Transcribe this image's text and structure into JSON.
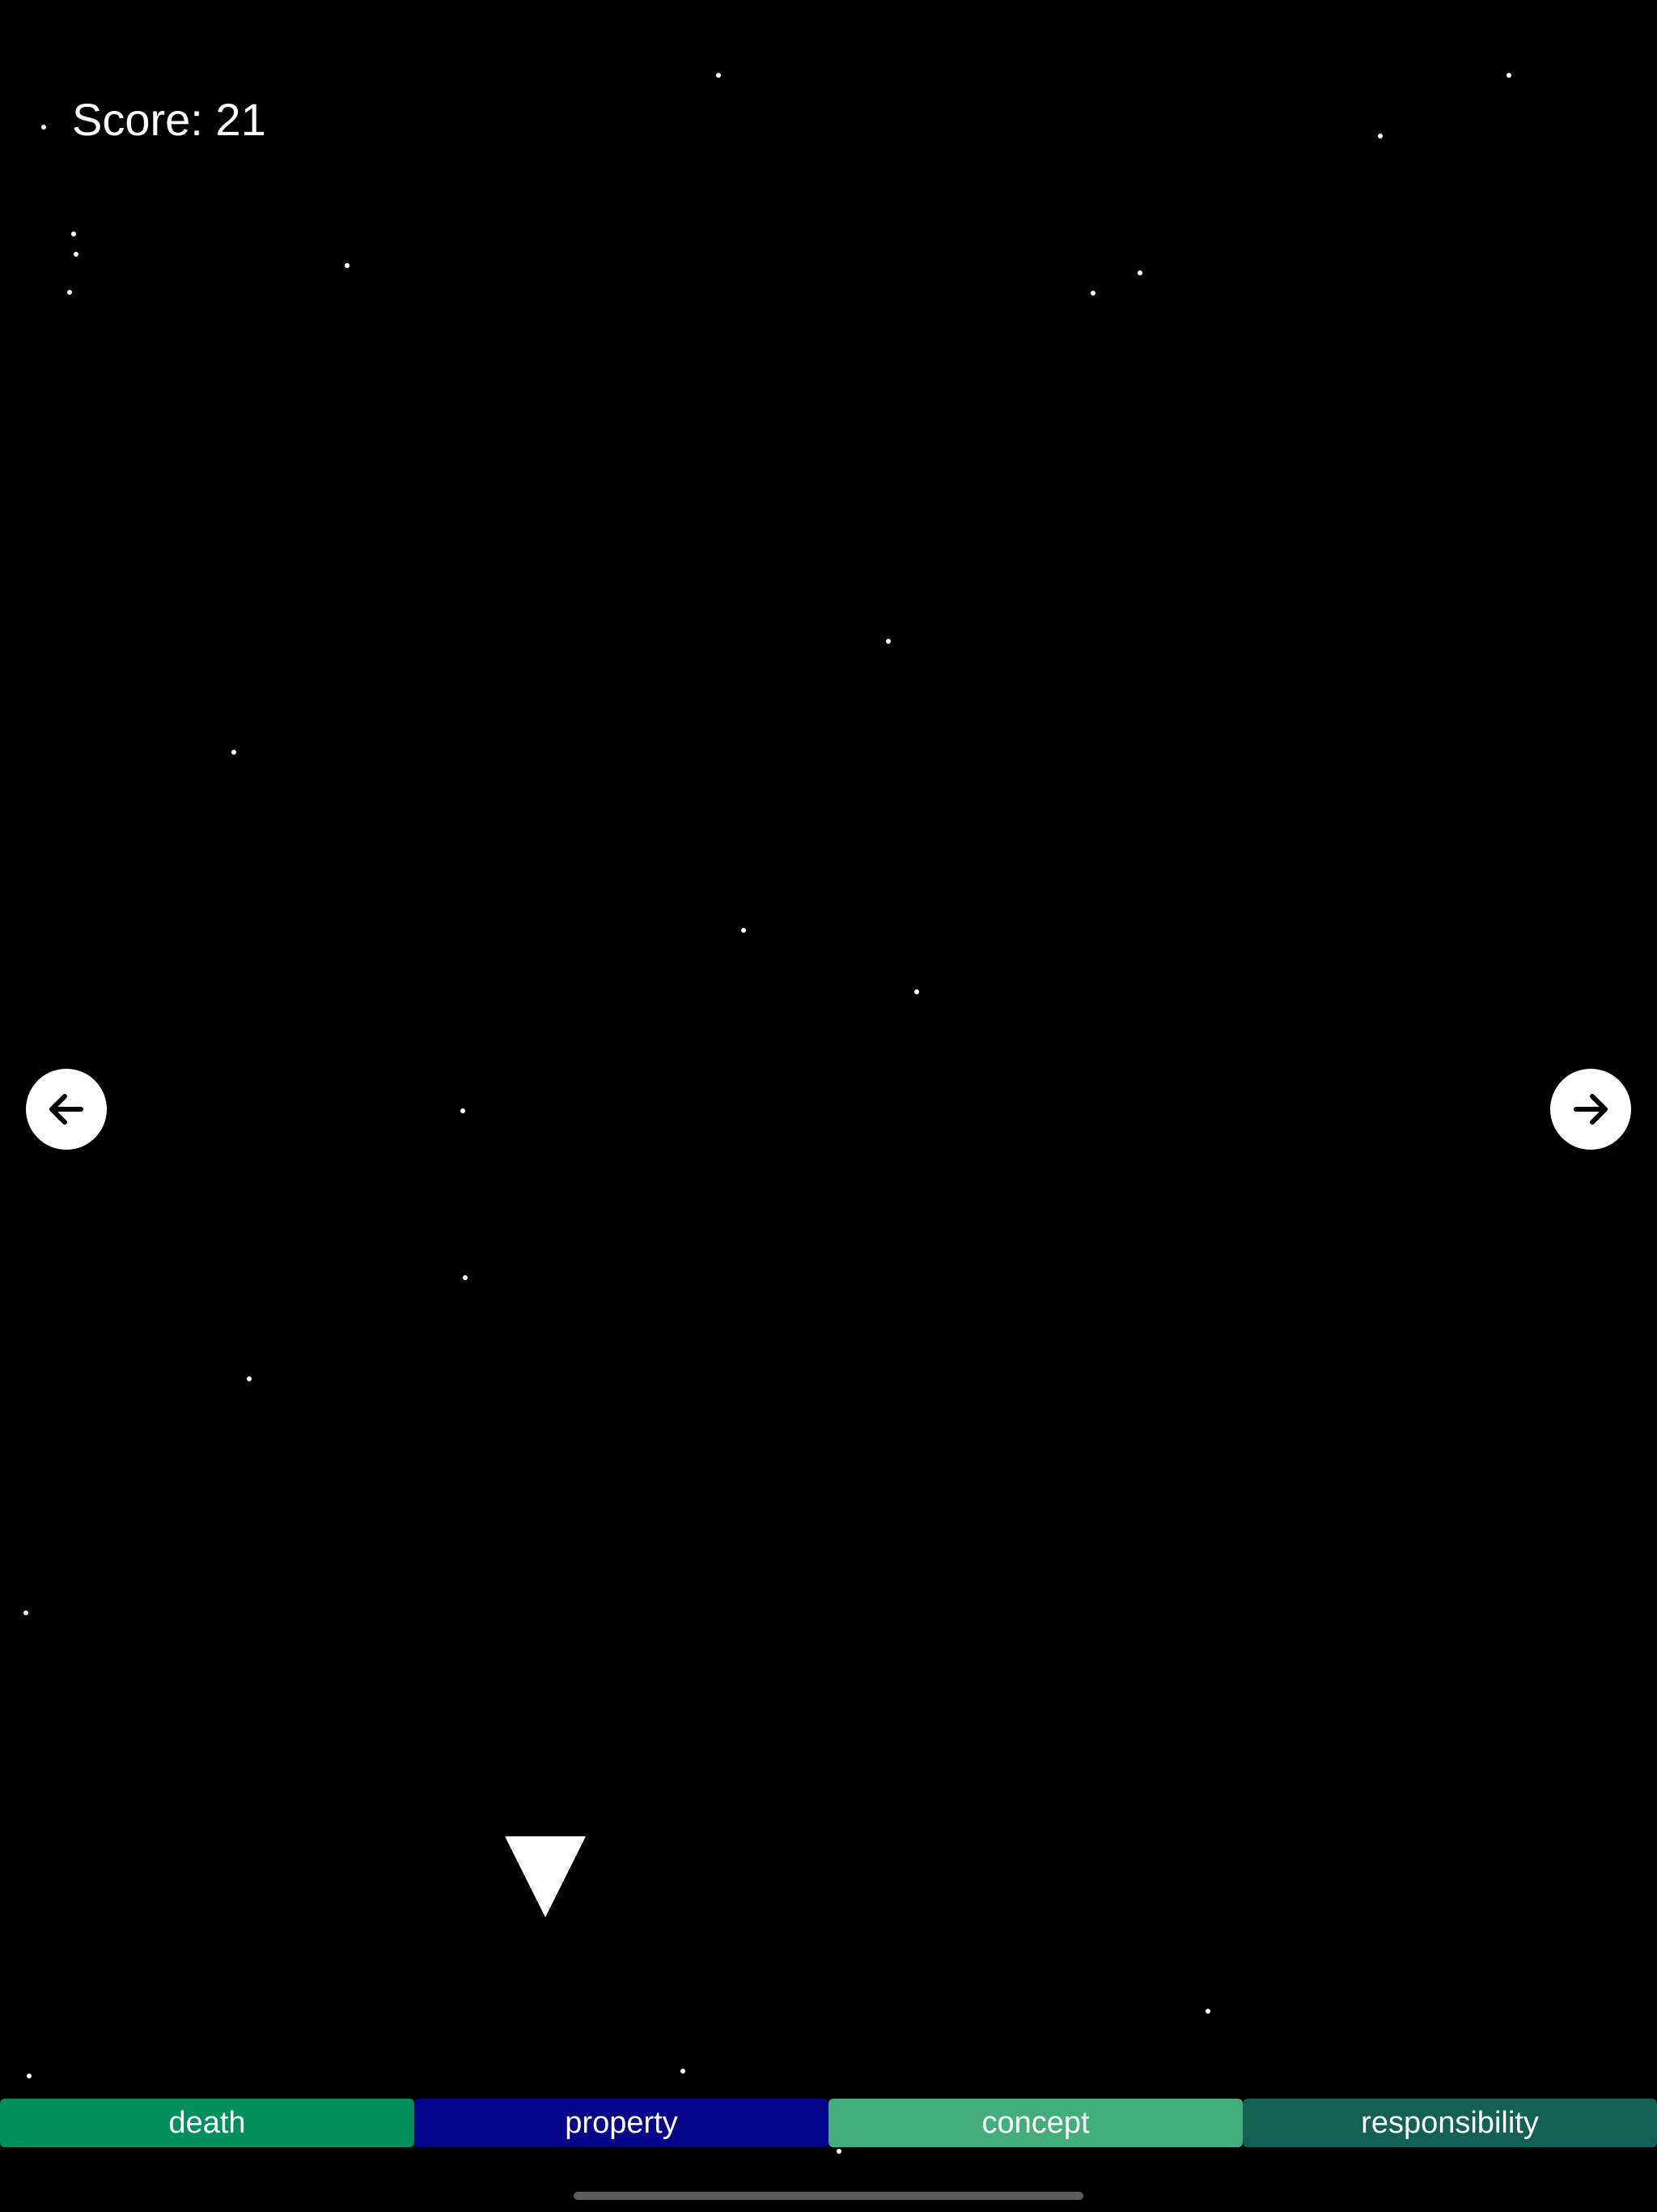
{
  "game": {
    "score_label": "Score:",
    "score_value": "21"
  },
  "controls": {
    "left_icon": "arrow-left-icon",
    "right_icon": "arrow-right-icon",
    "player_icon": "triangle-ship-icon"
  },
  "answers": [
    {
      "label": "death",
      "color": "#008F5D"
    },
    {
      "label": "property",
      "color": "#050589"
    },
    {
      "label": "concept",
      "color": "#44AE7A"
    },
    {
      "label": "responsibility",
      "color": "#136152"
    }
  ],
  "colors": {
    "background": "#000000",
    "foreground": "#FFFFFF"
  }
}
